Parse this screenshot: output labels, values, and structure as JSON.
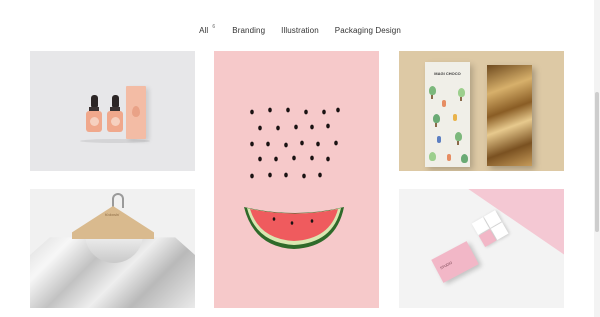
{
  "filters": {
    "all_label": "All",
    "all_count": "6",
    "branding_label": "Branding",
    "illustration_label": "Illustration",
    "packaging_label": "Packaging Design"
  },
  "tiles": {
    "chocolate_pack_title": "MAGI CHOCO",
    "hanger_text": "Kokoshi",
    "card_text": "STUDIO"
  },
  "colors": {
    "bottles_bg": "#e7e7e9",
    "watermelon_bg": "#f6c9ca",
    "chocolate_bg": "#ddc9a5",
    "cards_pink": "#f4c8d3"
  }
}
